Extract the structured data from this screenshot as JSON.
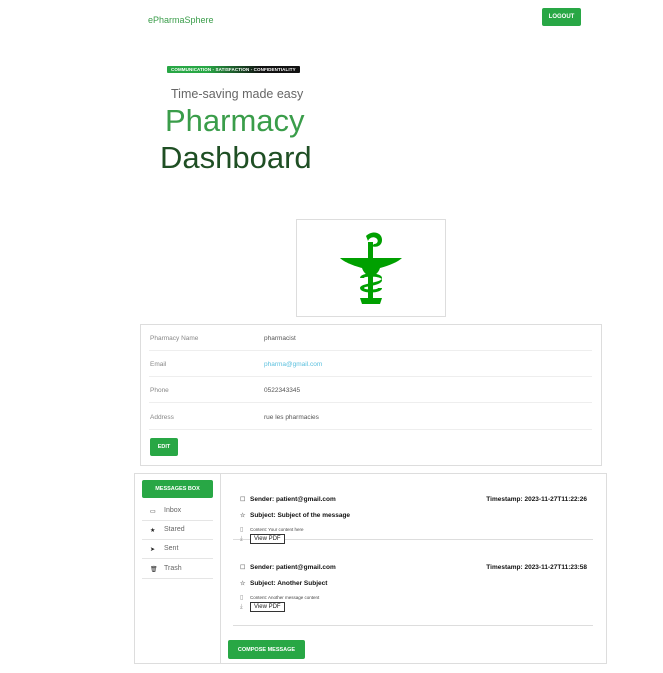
{
  "header": {
    "brand": "ePharmaSphere",
    "logout_label": "LOGOUT"
  },
  "hero": {
    "badge": "COMMUNICATION - SATISFACTION - CONFIDENTIALITY",
    "subtitle": "Time-saving made easy",
    "title_line1": "Pharmacy",
    "title_line2": "Dashboard"
  },
  "logo": {
    "icon": "pharmacy-bowl-of-hygieia-icon",
    "color": "#00a000"
  },
  "profile": {
    "fields": [
      {
        "label": "Pharmacy Name",
        "value": "pharmacist"
      },
      {
        "label": "Email",
        "value": "pharma@gmail.com"
      },
      {
        "label": "Phone",
        "value": "0522343345"
      },
      {
        "label": "Address",
        "value": "rue les pharmacies"
      }
    ],
    "edit_label": "EDIT"
  },
  "mailbox": {
    "title_button": "MESSAGES BOX",
    "nav": [
      {
        "icon": "inbox-icon",
        "label": "Inbox"
      },
      {
        "icon": "star-icon",
        "label": "Stared"
      },
      {
        "icon": "send-icon",
        "label": "Sent"
      },
      {
        "icon": "trash-icon",
        "label": "Trash"
      }
    ],
    "messages": [
      {
        "sender": "Sender: patient@gmail.com",
        "timestamp": "Timestamp: 2023-11-27T11:22:26",
        "subject": "Subject: Subject of the message",
        "content": "Content: Your content here",
        "pdf_label": "View PDF"
      },
      {
        "sender": "Sender: patient@gmail.com",
        "timestamp": "Timestamp: 2023-11-27T11:23:58",
        "subject": "Subject: Another Subject",
        "content": "Content: Another message content",
        "pdf_label": "View PDF"
      }
    ],
    "compose_label": "COMPOSE MESSAGE"
  },
  "colors": {
    "accent": "#28a745",
    "brand_text": "#3a9d4a",
    "title_dark": "#1f4f24",
    "link": "#5bc0de"
  }
}
